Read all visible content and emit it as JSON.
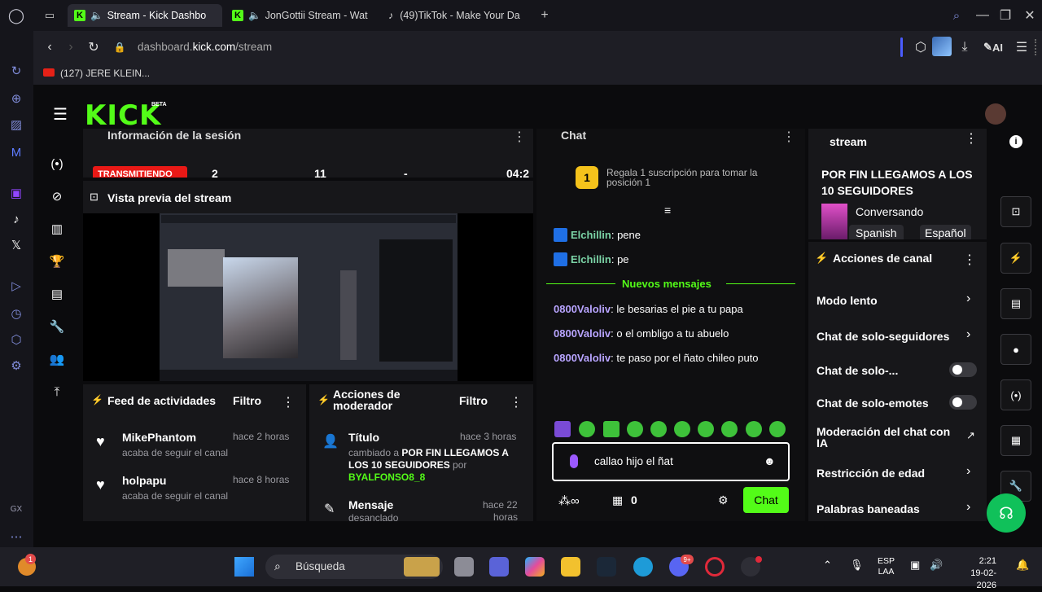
{
  "browser": {
    "tabs": [
      {
        "label": "Stream - Kick Dashbo"
      },
      {
        "label": "JonGottii Stream - Wat"
      },
      {
        "label": "(49)TikTok - Make Your Da"
      }
    ],
    "url_prefix": "dashboard.",
    "url_domain": "kick.com",
    "url_path": "/stream",
    "bookmark": "(127) JERE KLEIN...",
    "ai_label": "AI"
  },
  "kick": {
    "logo": "KICK",
    "beta": "BETA",
    "session": {
      "title": "Información de la sesión",
      "status": "TRANSMITIENDO",
      "stat1": "2",
      "stat2": "11",
      "stat3": "-",
      "time": "04:2"
    },
    "preview": {
      "title": "Vista previa del stream"
    },
    "feed": {
      "title": "Feed de actividades",
      "filter": "Filtro",
      "items": [
        {
          "user": "MikePhantom",
          "time": "hace 2 horas",
          "action": "acaba de seguir el canal"
        },
        {
          "user": "holpapu",
          "time": "hace 8 horas",
          "action": "acaba de seguir el canal"
        }
      ]
    },
    "modactions": {
      "title_line1": "Acciones de",
      "title_line2": "moderador",
      "filter": "Filtro",
      "item1_title": "Título",
      "item1_time": "hace 3 horas",
      "item1_pre": "cambiado a ",
      "item1_value": "POR FIN LLEGAMOS A LOS 10 SEGUIDORES",
      "item1_by": " por",
      "item1_user": "BYALFONSO8_8",
      "item2_title": "Mensaje",
      "item2_sub": "desanclado",
      "item2_time": "hace 22",
      "item2_time2": "horas"
    },
    "chat": {
      "title": "Chat",
      "gift_rank": "1",
      "gift_text_1": "Regala 1 suscripción para tomar la",
      "gift_text_2": "posición 1",
      "messages_old": [
        {
          "user": "Elchillin",
          "text": " pene"
        },
        {
          "user": "Elchillin",
          "text": " pe"
        }
      ],
      "new_divider": "Nuevos mensajes",
      "messages_new": [
        {
          "user": "0800Valoliv",
          "text": " le besarias el pie a tu papa"
        },
        {
          "user": "0800Valoliv",
          "text": " o el ombligo a tu abuelo"
        },
        {
          "user": "0800Valoliv",
          "text": " te paso por el ñato chileo puto"
        }
      ],
      "input_value": "callao hijo el ñat",
      "points": "0",
      "send_label": "Chat"
    },
    "streaminfo": {
      "header": "stream",
      "title": "POR FIN LLEGAMOS A LOS 10 SEGUIDORES",
      "category": "Conversando",
      "tags": [
        "Spanish",
        "Español"
      ]
    },
    "channel_actions": {
      "title": "Acciones de canal",
      "rows": [
        {
          "label": "Modo lento"
        },
        {
          "label": "Chat de solo-seguidores"
        },
        {
          "label": "Chat de solo-..."
        },
        {
          "label": "Chat de solo-emotes"
        },
        {
          "label": "Moderación del chat con IA"
        },
        {
          "label": "Restricción de edad"
        },
        {
          "label": "Palabras baneadas"
        }
      ]
    }
  },
  "taskbar": {
    "search_placeholder": "Búsqueda",
    "lang_1": "ESP",
    "lang_2": "LAA",
    "time": "2:21",
    "date": "19-02-2026",
    "badge": "1",
    "discord_badge": "9+"
  },
  "colors": {
    "kick_green": "#53fc18",
    "chat_purple": "#b8a4ff",
    "live_red": "#e91916"
  }
}
